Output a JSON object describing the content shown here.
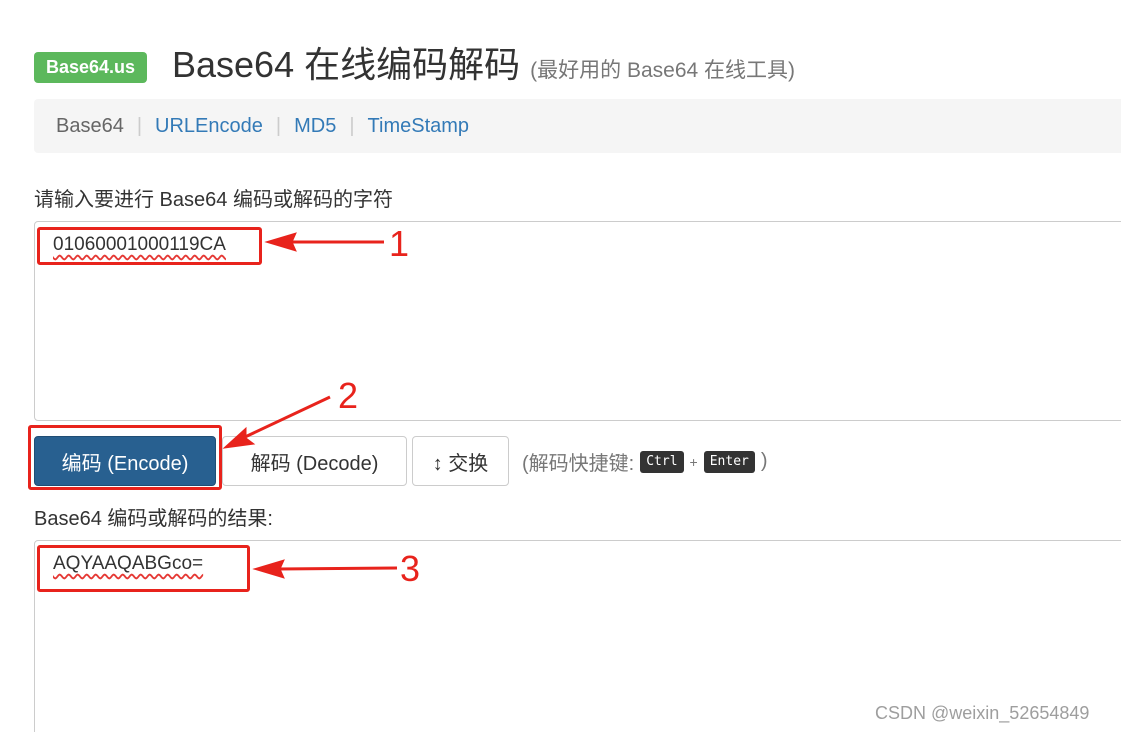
{
  "header": {
    "badge": "Base64.us",
    "title": "Base64 在线编码解码",
    "subtitle": "(最好用的 Base64 在线工具)"
  },
  "nav": {
    "items": [
      {
        "label": "Base64",
        "active": true
      },
      {
        "label": "URLEncode",
        "active": false
      },
      {
        "label": "MD5",
        "active": false
      },
      {
        "label": "TimeStamp",
        "active": false
      }
    ],
    "separator": "|"
  },
  "input": {
    "label": "请输入要进行 Base64 编码或解码的字符",
    "value": "01060001000119CA"
  },
  "buttons": {
    "encode": "编码 (Encode)",
    "decode": "解码 (Decode)",
    "swap": "↕ 交换"
  },
  "shortcut": {
    "prefix": "(解码快捷键:",
    "key1": "Ctrl",
    "plus": "+",
    "key2": "Enter",
    "suffix": ")"
  },
  "output": {
    "label": "Base64 编码或解码的结果:",
    "value": "AQYAAQABGco="
  },
  "annotations": {
    "n1": "1",
    "n2": "2",
    "n3": "3",
    "color": "#e8231c"
  },
  "watermark": "CSDN @weixin_52654849",
  "colors": {
    "badge": "#5cb85c",
    "primary": "#286090",
    "link": "#337ab7"
  }
}
